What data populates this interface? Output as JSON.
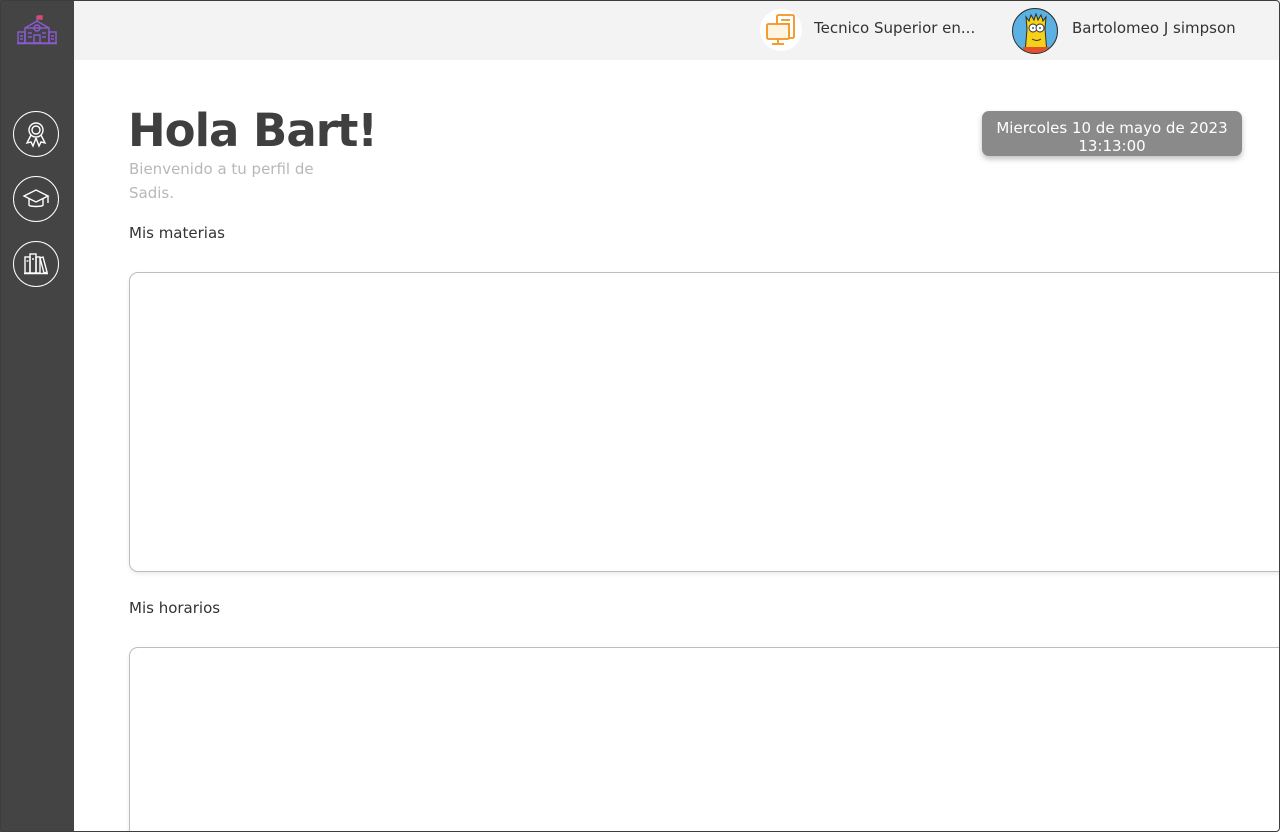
{
  "header": {
    "career_label": "Tecnico Superior en...",
    "user_name": "Bartolomeo J simpson"
  },
  "sidebar": {
    "logo_icon": "school-building-icon",
    "items": [
      {
        "icon": "award-ribbon-icon"
      },
      {
        "icon": "graduation-cap-icon"
      },
      {
        "icon": "books-icon"
      }
    ]
  },
  "main": {
    "greeting": "Hola Bart!",
    "subtitle": "Bienvenido a tu perfil de Sadis.",
    "date": "Miercoles 10 de mayo de 2023",
    "time": "13:13:00",
    "subjects_label": "Mis materias",
    "schedule_label": "Mis horarios"
  },
  "colors": {
    "sidebar": "#444444",
    "topbar": "#f3f3f3",
    "logo": "#8b5cd6",
    "career_icon": "#f0941f",
    "date_box": "#8a8a8a"
  }
}
